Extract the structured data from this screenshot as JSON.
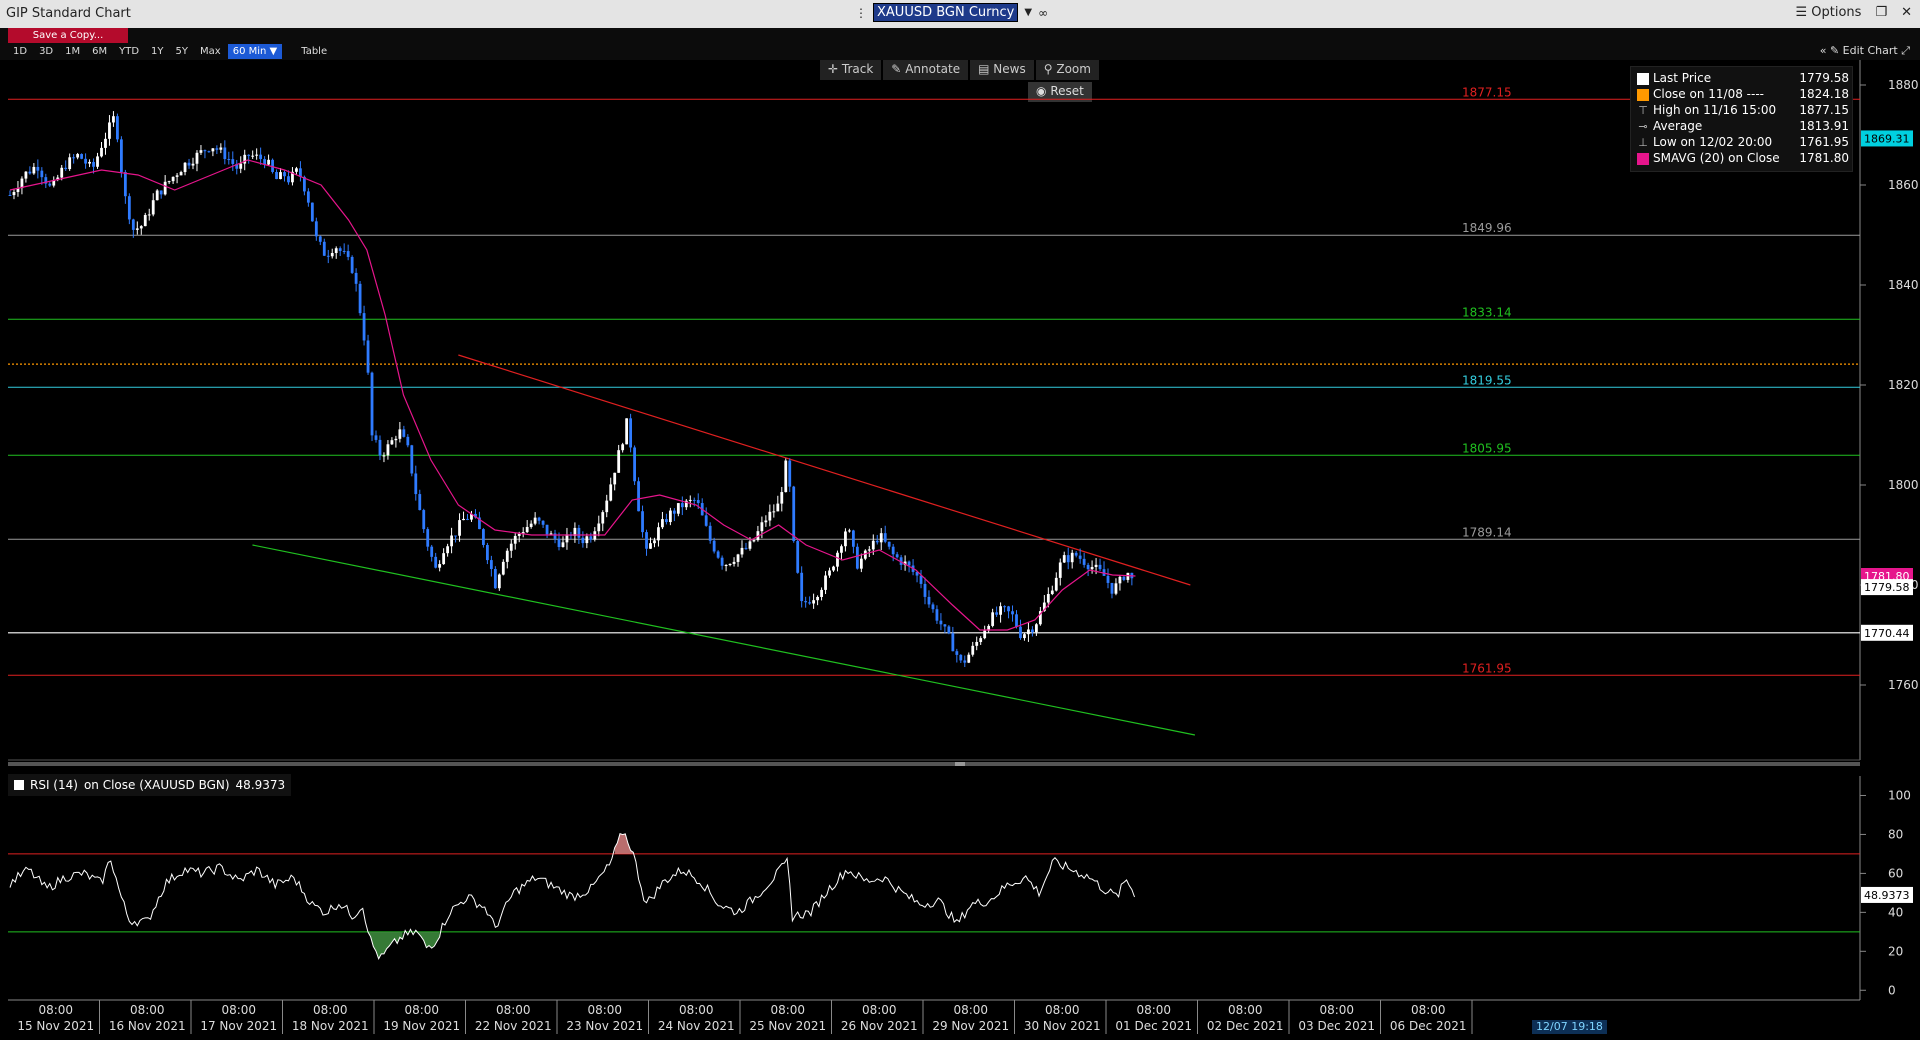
{
  "window": {
    "title": "GIP Standard Chart",
    "security": "XAUUSD BGN Curncy",
    "options_label": "Options"
  },
  "toolbar": {
    "save_label": "Save a Copy...",
    "ranges": [
      "1D",
      "3D",
      "1M",
      "6M",
      "YTD",
      "1Y",
      "5Y",
      "Max"
    ],
    "interval": "60 Min ▼",
    "table_label": "Table",
    "edit_chart_label": "Edit Chart"
  },
  "chart_tools": {
    "track": "Track",
    "annotate": "Annotate",
    "news": "News",
    "zoom": "Zoom",
    "reset": "Reset"
  },
  "legend": [
    {
      "icon": "white-square",
      "label": "Last Price",
      "value": "1779.58",
      "color": "#ffffff"
    },
    {
      "icon": "orange-square",
      "label": "Close on 11/08 ----",
      "value": "1824.18",
      "color": "#ff9900"
    },
    {
      "icon": "high-marker",
      "label": "High on 11/16 15:00",
      "value": "1877.15",
      "color": "#bbbbbb"
    },
    {
      "icon": "average-marker",
      "label": "Average",
      "value": "1813.91",
      "color": "#bbbbbb"
    },
    {
      "icon": "low-marker",
      "label": "Low on 12/02 20:00",
      "value": "1761.95",
      "color": "#bbbbbb"
    },
    {
      "icon": "magenta-square",
      "label": "SMAVG (20)  on Close",
      "value": "1781.80",
      "color": "#e6158c"
    }
  ],
  "rsi": {
    "label": "RSI (14)",
    "basis": "on Close (XAUUSD BGN)",
    "value": "48.9373"
  },
  "status_time": "12/07 19:18",
  "colors": {
    "candle_up": "#ffffff",
    "candle_down": "#2f7bff",
    "smavg": "#e6158c",
    "resistance": "#e02020",
    "support": "#20c020",
    "prev_close": "#ff9900"
  },
  "chart_data": [
    {
      "type": "candlestick",
      "interval": "60 Min",
      "ylim": [
        1745,
        1885
      ],
      "yticks": [
        1760,
        1780,
        1800,
        1820,
        1840,
        1860,
        1880
      ],
      "x_tick_time": "08:00",
      "x_dates": [
        "15 Nov 2021",
        "16 Nov 2021",
        "17 Nov 2021",
        "18 Nov 2021",
        "19 Nov 2021",
        "22 Nov 2021",
        "23 Nov 2021",
        "24 Nov 2021",
        "25 Nov 2021",
        "26 Nov 2021",
        "29 Nov 2021",
        "30 Nov 2021",
        "01 Dec 2021",
        "02 Dec 2021",
        "03 Dec 2021",
        "06 Dec 2021"
      ],
      "close_path": [
        [
          0,
          1858
        ],
        [
          0.15,
          1862
        ],
        [
          0.3,
          1864
        ],
        [
          0.45,
          1859
        ],
        [
          0.6,
          1864
        ],
        [
          0.75,
          1866
        ],
        [
          0.9,
          1863
        ],
        [
          1.0,
          1868
        ],
        [
          1.15,
          1874
        ],
        [
          1.25,
          1858
        ],
        [
          1.35,
          1851
        ],
        [
          1.45,
          1852
        ],
        [
          1.6,
          1858
        ],
        [
          1.75,
          1861
        ],
        [
          1.9,
          1864
        ],
        [
          2.05,
          1866
        ],
        [
          2.2,
          1868
        ],
        [
          2.35,
          1866
        ],
        [
          2.5,
          1863
        ],
        [
          2.6,
          1866
        ],
        [
          2.8,
          1865
        ],
        [
          2.9,
          1861
        ],
        [
          3.0,
          1862
        ],
        [
          3.05,
          1861
        ],
        [
          3.15,
          1863
        ],
        [
          3.25,
          1858
        ],
        [
          3.35,
          1849
        ],
        [
          3.45,
          1846
        ],
        [
          3.55,
          1848
        ],
        [
          3.65,
          1846
        ],
        [
          3.75,
          1843
        ],
        [
          3.8,
          1838
        ],
        [
          3.9,
          1826
        ],
        [
          3.95,
          1810
        ],
        [
          4.05,
          1806
        ],
        [
          4.15,
          1808
        ],
        [
          4.25,
          1811
        ],
        [
          4.35,
          1807
        ],
        [
          4.45,
          1797
        ],
        [
          4.55,
          1789
        ],
        [
          4.65,
          1783
        ],
        [
          4.75,
          1788
        ],
        [
          4.85,
          1790
        ],
        [
          4.95,
          1793
        ],
        [
          5.05,
          1794
        ],
        [
          5.15,
          1790
        ],
        [
          5.25,
          1784
        ],
        [
          5.3,
          1780
        ],
        [
          5.4,
          1786
        ],
        [
          5.5,
          1789
        ],
        [
          5.6,
          1791
        ],
        [
          5.75,
          1793
        ],
        [
          5.9,
          1790
        ],
        [
          6.05,
          1788
        ],
        [
          6.15,
          1791
        ],
        [
          6.25,
          1789
        ],
        [
          6.35,
          1790
        ],
        [
          6.5,
          1796
        ],
        [
          6.65,
          1806
        ],
        [
          6.75,
          1813
        ],
        [
          6.85,
          1798
        ],
        [
          6.95,
          1786
        ],
        [
          7.05,
          1790
        ],
        [
          7.2,
          1794
        ],
        [
          7.35,
          1796
        ],
        [
          7.5,
          1797
        ],
        [
          7.65,
          1789
        ],
        [
          7.8,
          1784
        ],
        [
          7.95,
          1786
        ],
        [
          8.1,
          1788
        ],
        [
          8.25,
          1793
        ],
        [
          8.4,
          1796
        ],
        [
          8.5,
          1806
        ],
        [
          8.55,
          1790
        ],
        [
          8.65,
          1776
        ],
        [
          8.8,
          1778
        ],
        [
          8.95,
          1782
        ],
        [
          9.05,
          1787
        ],
        [
          9.15,
          1792
        ],
        [
          9.25,
          1784
        ],
        [
          9.35,
          1786
        ],
        [
          9.5,
          1790
        ],
        [
          9.65,
          1786
        ],
        [
          9.8,
          1784
        ],
        [
          9.95,
          1781
        ],
        [
          10.05,
          1776
        ],
        [
          10.15,
          1773
        ],
        [
          10.3,
          1768
        ],
        [
          10.4,
          1764
        ],
        [
          10.55,
          1768
        ],
        [
          10.7,
          1773
        ],
        [
          10.85,
          1775
        ],
        [
          10.95,
          1774
        ],
        [
          11.05,
          1770
        ],
        [
          11.2,
          1772
        ],
        [
          11.35,
          1778
        ],
        [
          11.5,
          1785
        ],
        [
          11.65,
          1786
        ],
        [
          11.8,
          1784
        ],
        [
          11.95,
          1782
        ],
        [
          12.05,
          1779
        ],
        [
          12.15,
          1781
        ],
        [
          12.2,
          1783
        ],
        [
          12.3,
          1779.58
        ]
      ],
      "smavg_path": [
        [
          0,
          1859
        ],
        [
          0.5,
          1861
        ],
        [
          1.0,
          1863
        ],
        [
          1.4,
          1862
        ],
        [
          1.8,
          1859
        ],
        [
          2.2,
          1862
        ],
        [
          2.6,
          1865
        ],
        [
          3.0,
          1863
        ],
        [
          3.4,
          1860
        ],
        [
          3.7,
          1853
        ],
        [
          3.9,
          1847
        ],
        [
          4.1,
          1834
        ],
        [
          4.3,
          1818
        ],
        [
          4.6,
          1805
        ],
        [
          4.9,
          1796
        ],
        [
          5.3,
          1791
        ],
        [
          5.7,
          1790
        ],
        [
          6.1,
          1790
        ],
        [
          6.5,
          1790
        ],
        [
          6.8,
          1797
        ],
        [
          7.1,
          1798
        ],
        [
          7.5,
          1796
        ],
        [
          7.8,
          1792
        ],
        [
          8.1,
          1789
        ],
        [
          8.4,
          1792
        ],
        [
          8.7,
          1788
        ],
        [
          9.1,
          1785
        ],
        [
          9.5,
          1787
        ],
        [
          9.9,
          1783
        ],
        [
          10.3,
          1776
        ],
        [
          10.6,
          1771
        ],
        [
          10.9,
          1771
        ],
        [
          11.2,
          1773
        ],
        [
          11.5,
          1779
        ],
        [
          11.8,
          1783
        ],
        [
          12.05,
          1782
        ],
        [
          12.3,
          1781.8
        ]
      ],
      "horizontal_levels": [
        {
          "value": 1877.15,
          "label": "1877.15",
          "color": "#e02020"
        },
        {
          "value": 1849.96,
          "label": "1849.96",
          "color": "#9a9a9a"
        },
        {
          "value": 1833.14,
          "label": "1833.14",
          "color": "#20c020"
        },
        {
          "value": 1819.55,
          "label": "1819.55",
          "color": "#33ccdd"
        },
        {
          "value": 1805.95,
          "label": "1805.95",
          "color": "#20c020"
        },
        {
          "value": 1789.14,
          "label": "1789.14",
          "color": "#9a9a9a"
        },
        {
          "value": 1761.95,
          "label": "1761.95",
          "color": "#e02020"
        }
      ],
      "white_level": {
        "value": 1770.44,
        "label": "1770.44"
      },
      "prev_close_level": {
        "value": 1824.18
      },
      "trendlines": [
        {
          "name": "resistance",
          "from": [
            4.9,
            1826
          ],
          "to": [
            12.9,
            1780
          ],
          "color": "#e02020"
        },
        {
          "name": "support",
          "from": [
            2.65,
            1788
          ],
          "to": [
            12.95,
            1750
          ],
          "color": "#20c020"
        }
      ],
      "right_axis_badges": [
        {
          "label": "1869.31",
          "value": 1869.31,
          "bg": "#00d0e0",
          "fg": "#000000"
        },
        {
          "label": "1781.80",
          "value": 1781.8,
          "bg": "#e6158c",
          "fg": "#ffffff"
        },
        {
          "label": "1779.58",
          "value": 1779.58,
          "bg": "#ffffff",
          "fg": "#000000"
        },
        {
          "label": "1770.44",
          "value": 1770.44,
          "bg": "#ffffff",
          "fg": "#000000"
        }
      ]
    },
    {
      "type": "line",
      "series_name": "RSI (14)",
      "ylim": [
        -5,
        110
      ],
      "yticks": [
        0,
        20,
        40,
        60,
        80,
        100
      ],
      "overbought": 70,
      "oversold": 30,
      "last_value_label": "48.9373",
      "path": [
        [
          0,
          55
        ],
        [
          0.2,
          62
        ],
        [
          0.4,
          52
        ],
        [
          0.6,
          58
        ],
        [
          0.8,
          60
        ],
        [
          1.0,
          55
        ],
        [
          1.1,
          68
        ],
        [
          1.2,
          50
        ],
        [
          1.3,
          36
        ],
        [
          1.5,
          35
        ],
        [
          1.7,
          55
        ],
        [
          1.9,
          62
        ],
        [
          2.1,
          60
        ],
        [
          2.3,
          63
        ],
        [
          2.5,
          56
        ],
        [
          2.7,
          62
        ],
        [
          2.9,
          54
        ],
        [
          3.1,
          58
        ],
        [
          3.3,
          44
        ],
        [
          3.45,
          40
        ],
        [
          3.6,
          45
        ],
        [
          3.75,
          38
        ],
        [
          3.85,
          44
        ],
        [
          3.95,
          24
        ],
        [
          4.05,
          16
        ],
        [
          4.15,
          22
        ],
        [
          4.3,
          28
        ],
        [
          4.45,
          30
        ],
        [
          4.55,
          22
        ],
        [
          4.65,
          25
        ],
        [
          4.8,
          40
        ],
        [
          5.0,
          48
        ],
        [
          5.2,
          42
        ],
        [
          5.3,
          32
        ],
        [
          5.5,
          50
        ],
        [
          5.75,
          58
        ],
        [
          5.95,
          53
        ],
        [
          6.15,
          48
        ],
        [
          6.35,
          52
        ],
        [
          6.55,
          64
        ],
        [
          6.7,
          82
        ],
        [
          6.8,
          72
        ],
        [
          6.95,
          44
        ],
        [
          7.15,
          56
        ],
        [
          7.35,
          62
        ],
        [
          7.55,
          56
        ],
        [
          7.75,
          44
        ],
        [
          7.95,
          40
        ],
        [
          8.15,
          48
        ],
        [
          8.35,
          58
        ],
        [
          8.5,
          66
        ],
        [
          8.55,
          38
        ],
        [
          8.75,
          40
        ],
        [
          8.95,
          52
        ],
        [
          9.15,
          62
        ],
        [
          9.35,
          56
        ],
        [
          9.55,
          58
        ],
        [
          9.75,
          50
        ],
        [
          9.95,
          44
        ],
        [
          10.15,
          46
        ],
        [
          10.35,
          34
        ],
        [
          10.5,
          44
        ],
        [
          10.7,
          46
        ],
        [
          10.9,
          54
        ],
        [
          11.1,
          58
        ],
        [
          11.25,
          50
        ],
        [
          11.4,
          66
        ],
        [
          11.6,
          62
        ],
        [
          11.8,
          58
        ],
        [
          11.95,
          52
        ],
        [
          12.1,
          48
        ],
        [
          12.2,
          57
        ],
        [
          12.3,
          48.94
        ]
      ]
    }
  ]
}
